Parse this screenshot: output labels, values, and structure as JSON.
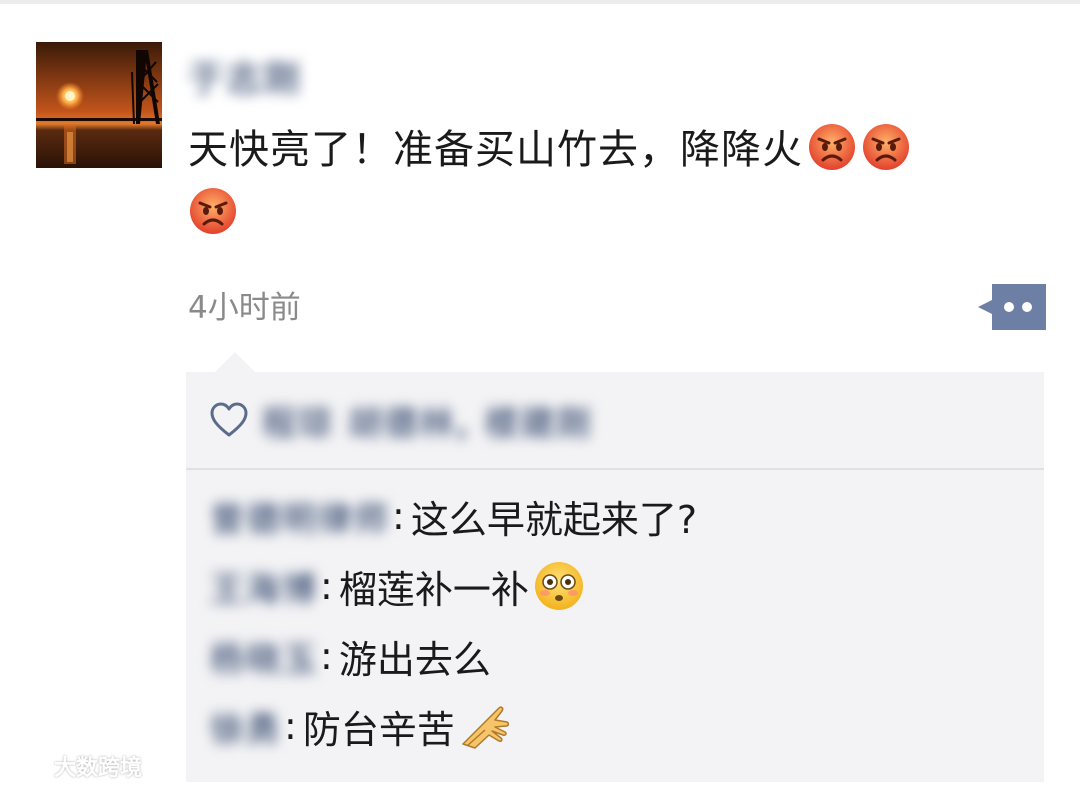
{
  "post": {
    "username": "于志刚",
    "text": "天快亮了！准备买山竹去，降降火",
    "timestamp": "4小时前",
    "avatar": "sunset-photo",
    "emoji_name": "angry-face-emoji",
    "emoji_count": 3
  },
  "more_button": {
    "icon": "comment-ellipsis-icon",
    "color": "#6e7fa5"
  },
  "likes": {
    "icon": "heart-outline-icon",
    "names": "程琼 胡德林, 楼建刚"
  },
  "comments": [
    {
      "author": "曾德明律师",
      "separator": ":",
      "text": "这么早就起来了?",
      "emoji": ""
    },
    {
      "author": "王海博",
      "separator": ":",
      "text": "榴莲补一补",
      "emoji": "flushed-face-emoji"
    },
    {
      "author": "杨晓玉",
      "separator": ":",
      "text": "游出去么",
      "emoji": ""
    },
    {
      "author": "徐勇",
      "separator": ":",
      "text": "防台辛苦",
      "emoji": "pinched-fingers-emoji"
    }
  ],
  "watermark": {
    "text": "大数跨境",
    "icon": "brand-logo-icon"
  },
  "colors": {
    "name_blue": "#5b6b8a",
    "box_bg": "#f3f3f5",
    "timestamp_gray": "#8a8a8a"
  }
}
